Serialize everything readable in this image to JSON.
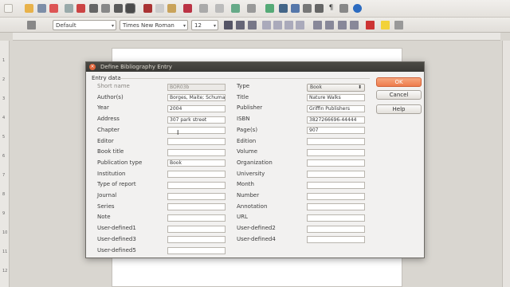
{
  "toolbar": {
    "paragraph_style": "Default",
    "font_name": "Times New Roman",
    "font_size": "12"
  },
  "dialog": {
    "title": "Define Bibliography Entry",
    "group_label": "Entry data",
    "buttons": {
      "ok": "OK",
      "cancel": "Cancel",
      "help": "Help"
    },
    "left_fields": [
      {
        "label": "Short name",
        "value": "BOR03b",
        "disabled": true
      },
      {
        "label": "Author(s)",
        "value": "Borges, Maite; Schumac"
      },
      {
        "label": "Year",
        "value": "2004"
      },
      {
        "label": "Address",
        "value": "307 park street"
      },
      {
        "label": "Chapter",
        "value": ""
      },
      {
        "label": "Editor",
        "value": ""
      },
      {
        "label": "Book title",
        "value": ""
      },
      {
        "label": "Publication type",
        "value": "Book"
      },
      {
        "label": "Institution",
        "value": ""
      },
      {
        "label": "Type of report",
        "value": ""
      },
      {
        "label": "Journal",
        "value": ""
      },
      {
        "label": "Series",
        "value": ""
      },
      {
        "label": "Note",
        "value": ""
      },
      {
        "label": "User-defined1",
        "value": ""
      },
      {
        "label": "User-defined3",
        "value": ""
      },
      {
        "label": "User-defined5",
        "value": ""
      }
    ],
    "right_fields": [
      {
        "label": "Type",
        "value": "Book",
        "select": true
      },
      {
        "label": "Title",
        "value": "Nature Walks"
      },
      {
        "label": "Publisher",
        "value": "Griffin Publishers"
      },
      {
        "label": "ISBN",
        "value": "3827266696-44444"
      },
      {
        "label": "Page(s)",
        "value": "907"
      },
      {
        "label": "Edition",
        "value": ""
      },
      {
        "label": "Volume",
        "value": ""
      },
      {
        "label": "Organization",
        "value": ""
      },
      {
        "label": "University",
        "value": ""
      },
      {
        "label": "Month",
        "value": ""
      },
      {
        "label": "Number",
        "value": ""
      },
      {
        "label": "Annotation",
        "value": ""
      },
      {
        "label": "URL",
        "value": ""
      },
      {
        "label": "User-defined2",
        "value": ""
      },
      {
        "label": "User-defined4",
        "value": ""
      }
    ]
  },
  "ruler": {
    "vertical_numbers": [
      "1",
      "2",
      "3",
      "4",
      "5",
      "6",
      "7",
      "8",
      "9",
      "10",
      "11",
      "12"
    ]
  },
  "colors": {
    "ok_button": "#ee7c4d",
    "title_bar": "#3c3b37",
    "close_button": "#e0643a"
  }
}
